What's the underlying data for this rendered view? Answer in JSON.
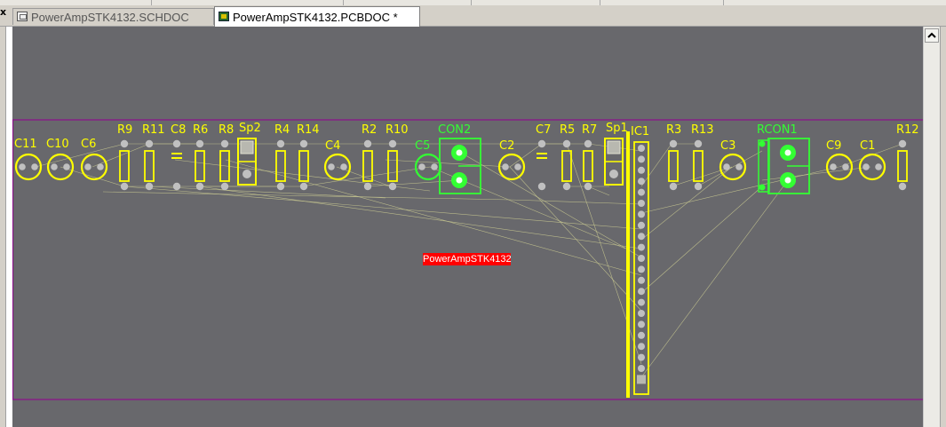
{
  "tabs": [
    {
      "label": "PowerAmpSTK4132.SCHDOC",
      "active": false,
      "icon": "schematic-doc-icon"
    },
    {
      "label": "PowerAmpSTK4132.PCBDOC *",
      "active": true,
      "icon": "pcb-doc-icon"
    }
  ],
  "close_glyph": "x",
  "colors": {
    "canvas": "#68686c",
    "board_outline": "#8c0f8c",
    "silkscreen": "#ffff00",
    "connector": "#33ff33",
    "pad": "#c0c0c0",
    "ratsnest": "#c8c890",
    "label_bg": "#ff0000"
  },
  "board": {
    "name_label": "PowerAmpSTK4132"
  },
  "components": {
    "C11": "C11",
    "C10": "C10",
    "C6": "C6",
    "R9": "R9",
    "R11": "R11",
    "C8": "C8",
    "R6": "R6",
    "R8": "R8",
    "Sp2": "Sp2",
    "R4": "R4",
    "R14": "R14",
    "C4": "C4",
    "R2": "R2",
    "R10": "R10",
    "C5": "C5",
    "CON2": "CON2",
    "C2": "C2",
    "C7": "C7",
    "R5": "R5",
    "R7": "R7",
    "Sp1": "Sp1",
    "IC1": "IC1",
    "R3": "R3",
    "R13": "R13",
    "C3": "C3",
    "RCON1": "RCON1",
    "C9": "C9",
    "C1": "C1",
    "R12": "R12"
  }
}
